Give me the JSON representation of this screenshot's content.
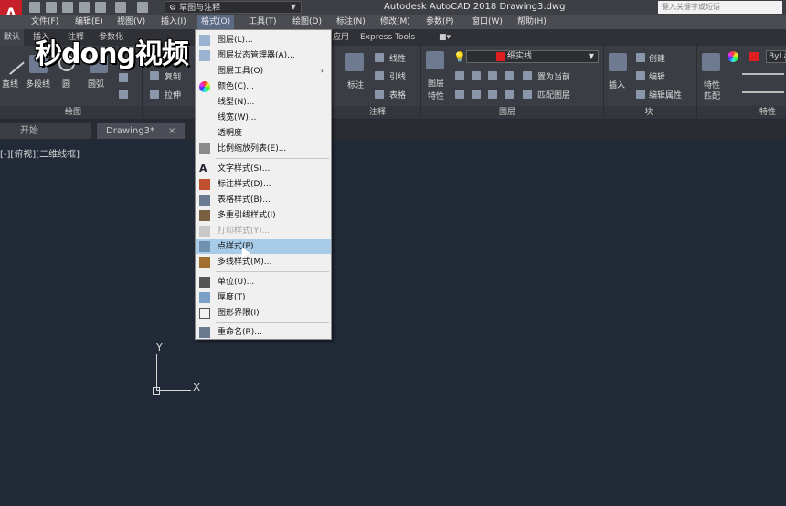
{
  "title_bar": {
    "workspace": "草图与注释",
    "title": "Autodesk AutoCAD 2018    Drawing3.dwg",
    "search_placeholder": "键入关键字或短语"
  },
  "menu_bar": {
    "items": [
      "文件(F)",
      "编辑(E)",
      "视图(V)",
      "插入(I)",
      "格式(O)",
      "工具(T)",
      "绘图(D)",
      "标注(N)",
      "修改(M)",
      "参数(P)",
      "窗口(W)",
      "帮助(H)"
    ]
  },
  "ribbon_tabs": {
    "items": [
      "默认",
      "插入",
      "注释",
      "参数化",
      "应用",
      "Express Tools"
    ]
  },
  "ribbon": {
    "draw": {
      "line": "直线",
      "polyline": "多段线",
      "circle": "圆",
      "arc": "圆弧",
      "title": "绘图"
    },
    "modify": {
      "copy": "复制",
      "stretch": "拉伸"
    },
    "annotation": {
      "dimension": "标注",
      "linear": "线性",
      "leader": "引线",
      "table": "表格",
      "title": "注释"
    },
    "layers": {
      "props_line1": "图层",
      "props_line2": "特性",
      "set_current": "置为当前",
      "match_layer": "匹配图层",
      "layer_name": "细实线",
      "title": "图层"
    },
    "block": {
      "insert": "插入",
      "create": "创建",
      "edit": "编辑",
      "edit_attr": "编辑属性",
      "title": "块"
    },
    "properties": {
      "match_line1": "特性",
      "match_line2": "匹配",
      "bylayer": "ByLa",
      "title": "特性"
    }
  },
  "file_tabs": {
    "start": "开始",
    "drawing": "Drawing3*",
    "close": "×"
  },
  "viewport_label": "[-][俯视][二维线框]",
  "ucs": {
    "x": "X",
    "y": "Y"
  },
  "watermark": "秒dong视频",
  "format_menu": {
    "items": [
      {
        "label": "图层(L)...",
        "icon": "layer-icon"
      },
      {
        "label": "图层状态管理器(A)...",
        "icon": "layer-state-icon"
      },
      {
        "label": "图层工具(O)",
        "icon": "",
        "submenu": "›"
      },
      {
        "label": "颜色(C)...",
        "icon": "color-wheel-icon"
      },
      {
        "label": "线型(N)...",
        "icon": ""
      },
      {
        "label": "线宽(W)...",
        "icon": ""
      },
      {
        "label": "透明度",
        "icon": ""
      },
      {
        "label": "比例缩放列表(E)...",
        "icon": "scale-list-icon"
      },
      {
        "label": "文字样式(S)...",
        "icon": "text-style-icon"
      },
      {
        "label": "标注样式(D)...",
        "icon": "dim-style-icon"
      },
      {
        "label": "表格样式(B)...",
        "icon": "table-style-icon"
      },
      {
        "label": "多重引线样式(I)",
        "icon": "mleader-style-icon"
      },
      {
        "label": "打印样式(Y)...",
        "icon": "plot-style-icon"
      },
      {
        "label": "点样式(P)...",
        "icon": "point-style-icon"
      },
      {
        "label": "多线样式(M)...",
        "icon": "mline-style-icon"
      },
      {
        "label": "单位(U)...",
        "icon": "units-icon"
      },
      {
        "label": "厚度(T)",
        "icon": "thickness-icon"
      },
      {
        "label": "图形界限(I)",
        "icon": "limits-icon"
      },
      {
        "label": "重命名(R)...",
        "icon": "rename-icon"
      }
    ]
  }
}
